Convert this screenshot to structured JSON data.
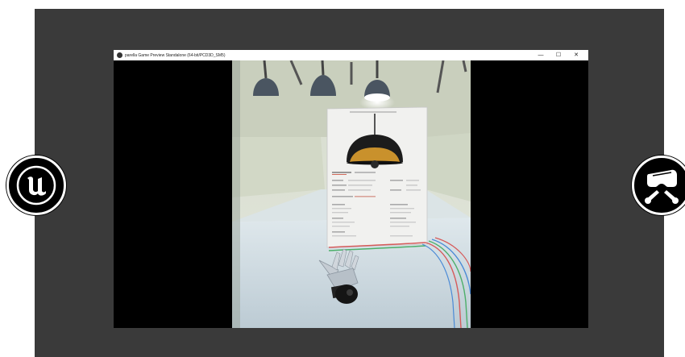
{
  "window": {
    "title": "parella Game Preview Standalone (64-bit/PCD3D_SM5)",
    "controls": {
      "minimize": "—",
      "maximize": "☐",
      "close": "✕"
    }
  },
  "badges": {
    "left": {
      "icon": "unreal-engine-logo"
    },
    "right": {
      "icon": "vr-headset-controllers"
    }
  },
  "colors": {
    "background": "#3a3a3a",
    "badge": "#000000",
    "window_bg": "#000000"
  }
}
